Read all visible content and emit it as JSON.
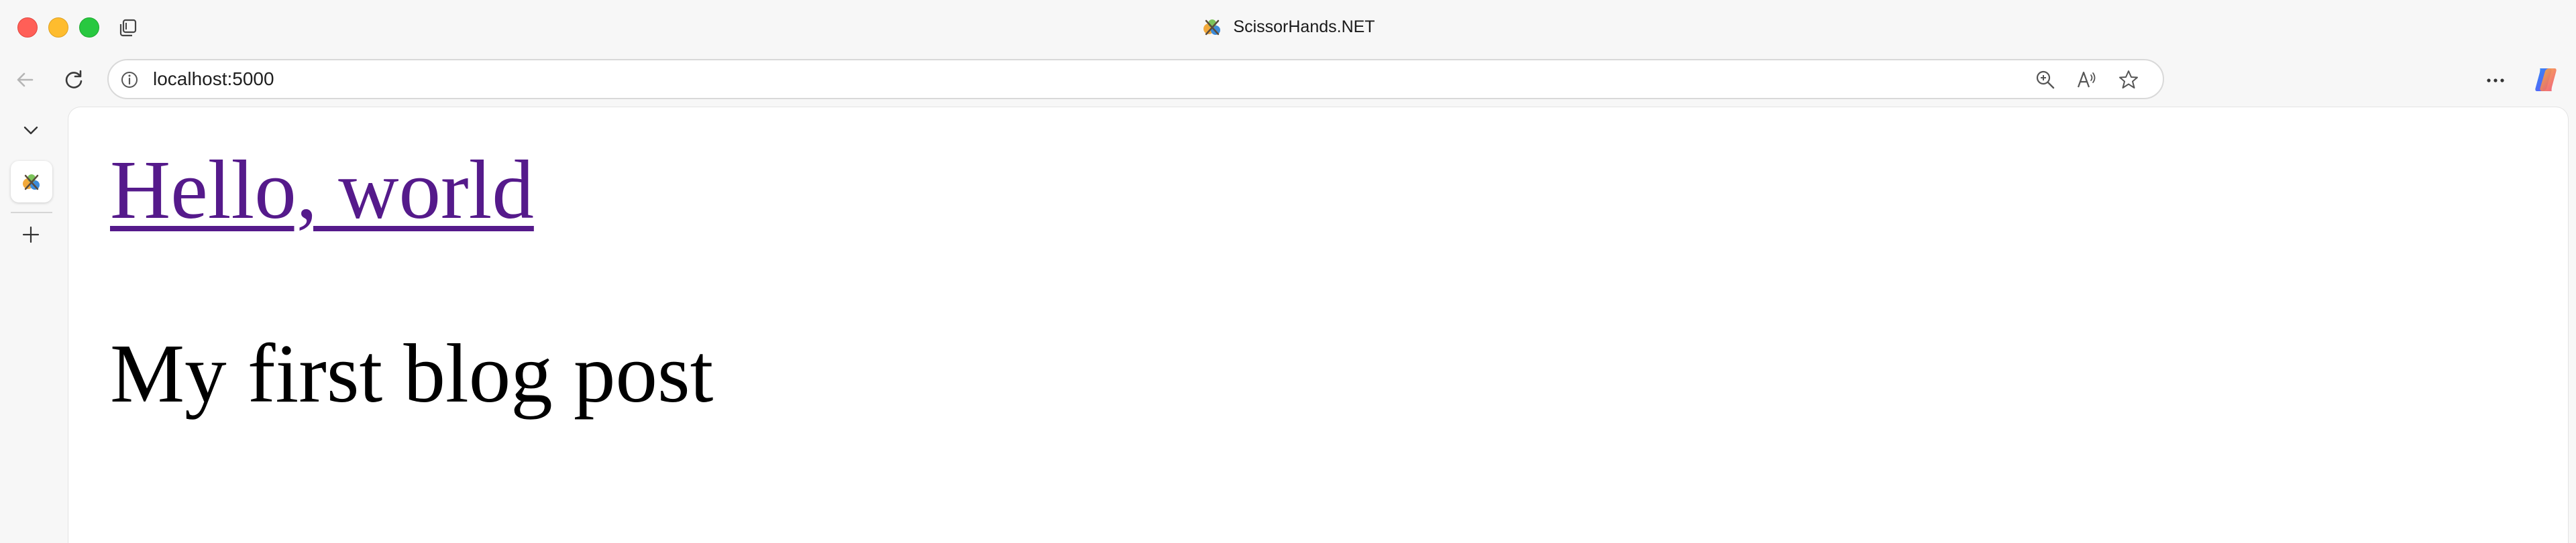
{
  "window": {
    "title": "ScissorHands.NET"
  },
  "toolbar": {
    "url": "localhost:5000"
  },
  "page": {
    "heading_link": "Hello, world",
    "post_title": "My first blog post"
  },
  "colors": {
    "link_visited": "#551a8b",
    "traffic_close": "#ff5f57",
    "traffic_minimize": "#febc2e",
    "traffic_maximize": "#28c840"
  },
  "icons": {
    "tab_actions": "tab-actions-icon",
    "favicon": "scissorhands-favicon",
    "back": "back-arrow-icon",
    "reload": "reload-icon",
    "site_info": "info-icon",
    "zoom": "zoom-in-icon",
    "read_aloud": "read-aloud-icon",
    "favorite": "star-icon",
    "more": "more-dots-icon",
    "copilot": "copilot-icon",
    "collapse_sidebar": "chevron-down-icon",
    "new_tab": "plus-icon"
  }
}
